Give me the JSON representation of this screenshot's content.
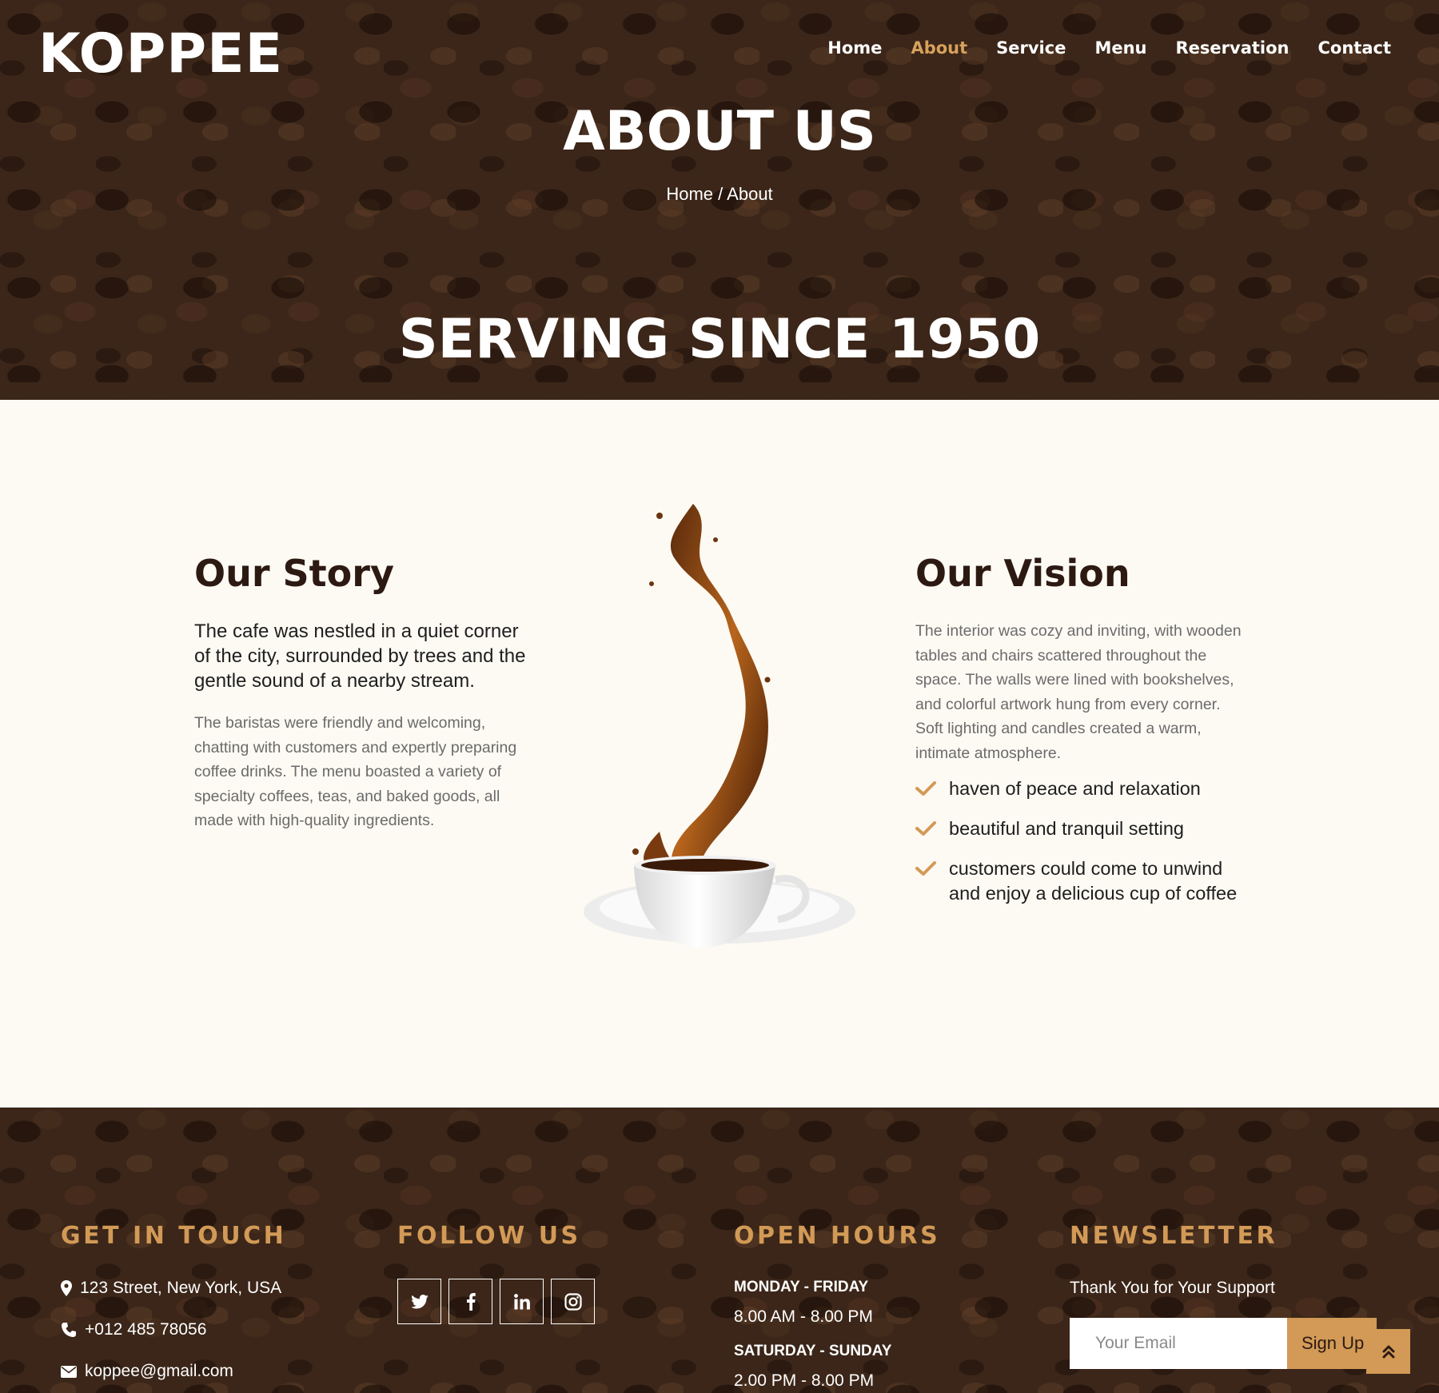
{
  "brand": {
    "logo": "KOPPEE"
  },
  "nav": {
    "items": [
      {
        "label": "Home"
      },
      {
        "label": "About",
        "active": true
      },
      {
        "label": "Service"
      },
      {
        "label": "Menu"
      },
      {
        "label": "Reservation"
      },
      {
        "label": "Contact"
      }
    ]
  },
  "hero": {
    "title": "ABOUT US",
    "breadcrumb_home": "Home",
    "breadcrumb_separator": "/",
    "breadcrumb_current": "About",
    "tagline": "SERVING SINCE 1950"
  },
  "story": {
    "title": "Our Story",
    "lead": "The cafe was nestled in a quiet corner of the city, surrounded by trees and the gentle sound of a nearby stream.",
    "body": "The baristas were friendly and welcoming, chatting with customers and expertly preparing coffee drinks. The menu boasted a variety of specialty coffees, teas, and baked goods, all made with high-quality ingredients."
  },
  "vision": {
    "title": "Our Vision",
    "body": "The interior was cozy and inviting, with wooden tables and chairs scattered throughout the space. The walls were lined with bookshelves, and colorful artwork hung from every corner. Soft lighting and candles created a warm, intimate atmosphere.",
    "points": [
      "haven of peace and relaxation",
      "beautiful and tranquil setting",
      "customers could come to unwind and enjoy a delicious cup of coffee"
    ]
  },
  "footer": {
    "touch": {
      "title": "GET IN TOUCH",
      "address": "123 Street, New York, USA",
      "phone": "+012 485 78056",
      "email": "koppee@gmail.com"
    },
    "follow": {
      "title": "FOLLOW US",
      "icons": [
        "twitter-icon",
        "facebook-icon",
        "linkedin-icon",
        "instagram-icon"
      ]
    },
    "hours": {
      "title": "OPEN HOURS",
      "weekdays": "MONDAY - FRIDAY",
      "weekdays_time": "8.00 AM - 8.00 PM",
      "weekend": "SATURDAY - SUNDAY",
      "weekend_time": "2.00 PM - 8.00 PM"
    },
    "newsletter": {
      "title": "NEWSLETTER",
      "text": "Thank You for Your Support",
      "placeholder": "Your Email",
      "button": "Sign Up"
    }
  },
  "colors": {
    "accent": "#d29a56",
    "dark": "#3b2619",
    "cream": "#fdfaf3",
    "heading": "#2c1a12"
  }
}
